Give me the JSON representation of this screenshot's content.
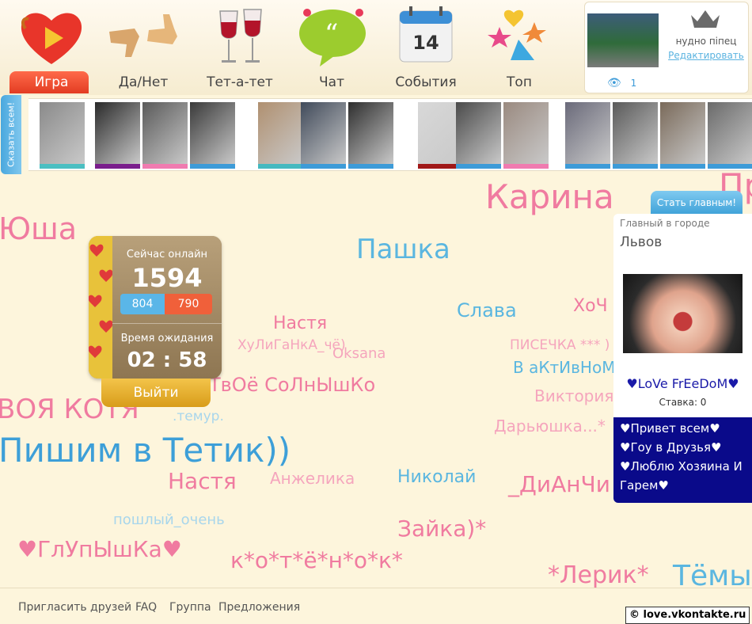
{
  "nav": [
    {
      "label": "Игра",
      "icon": "heart-play-icon",
      "active": true
    },
    {
      "label": "Да/Нет",
      "icon": "thumbs-up-down-icon",
      "active": false
    },
    {
      "label": "Тет-а-тет",
      "icon": "wine-glasses-icon",
      "active": false
    },
    {
      "label": "Чат",
      "icon": "chat-bubble-icon",
      "active": false
    },
    {
      "label": "События",
      "icon": "calendar-icon",
      "active": false
    },
    {
      "label": "Топ",
      "icon": "stars-bouquet-icon",
      "active": false
    }
  ],
  "calendar_day": "14",
  "profile": {
    "name": "нудно піпец",
    "edit_label": "Редактировать",
    "views": "1"
  },
  "say_all_label": "Сказать всем!",
  "strip_bar_colors": [
    "#4bbfc2",
    "#7a1e8c",
    "#f07bb0",
    "#3d9bd8",
    "#45b9c0",
    "#3d9bd8",
    "#3d9bd8",
    "#a01818",
    "#3d9bd8",
    "#f07bb0",
    "#3d9bd8",
    "#3d9bd8",
    "#3d9bd8",
    "#3d9bd8"
  ],
  "online": {
    "title": "Сейчас онлайн",
    "count": "1594",
    "male": "804",
    "female": "790",
    "wait_label": "Время ожидания",
    "timer": "02 : 58",
    "logout_label": "Выйти"
  },
  "main_in_city": {
    "button": "Стать главным!",
    "label": "Главный в городе",
    "city": "Львов",
    "nickname": "♥LoVe FrEeDoM♥",
    "bid": "Ставка: 0",
    "message": [
      "♥Привет всем♥",
      "♥Гоу в Друзья♥",
      "♥Люблю Хозяина И Гарем♥"
    ]
  },
  "cloud": [
    {
      "text": "Карина",
      "color": "#f07ba0"
    },
    {
      "text": "Пр",
      "color": "#f07ba0"
    },
    {
      "text": "Юша",
      "color": "#f07ba0"
    },
    {
      "text": "Пашка",
      "color": "#5ab6e0"
    },
    {
      "text": "Слава",
      "color": "#5ab6e0"
    },
    {
      "text": "ХоЧ",
      "color": "#f07ba0"
    },
    {
      "text": "Настя",
      "color": "#f07ba0"
    },
    {
      "text": "ХуЛиГаНкА_чё)",
      "color": "#f5a5bd"
    },
    {
      "text": "Oksana",
      "color": "#f5a5bd"
    },
    {
      "text": "ПИСЕЧКА *** )",
      "color": "#f5a5bd"
    },
    {
      "text": "В аКтИвНоМ",
      "color": "#5ab6e0"
    },
    {
      "text": "ТвОё СоЛнЫшКо",
      "color": "#f07ba0"
    },
    {
      "text": "Виктория",
      "color": "#f5a5bd"
    },
    {
      "text": "ВОЯ КОТЯ",
      "color": "#f07ba0"
    },
    {
      "text": ".темур.",
      "color": "#a8d6ec"
    },
    {
      "text": "Дарьюшка...*",
      "color": "#f5a5bd"
    },
    {
      "text": "Пишим в Тетик))",
      "color": "#3d9fd8"
    },
    {
      "text": "Настя",
      "color": "#f07ba0"
    },
    {
      "text": "Анжелика",
      "color": "#f5a5bd"
    },
    {
      "text": "Николай",
      "color": "#5ab6e0"
    },
    {
      "text": "_ДиАнЧи",
      "color": "#f07ba0"
    },
    {
      "text": "пошлый_очень",
      "color": "#a8d6ec"
    },
    {
      "text": "Зайка)*",
      "color": "#f07ba0"
    },
    {
      "text": "♥ГлУпЫшКа♥",
      "color": "#f07ba0"
    },
    {
      "text": "к*о*т*ё*н*о*к*",
      "color": "#f07ba0"
    },
    {
      "text": "*Лерик*",
      "color": "#f07ba0"
    },
    {
      "text": "Тёмы",
      "color": "#5ab6e0"
    }
  ],
  "footer": {
    "links": [
      "Пригласить друзей",
      "FAQ",
      "Группа",
      "Предложения"
    ],
    "copyright": "© love.vkontakte.ru"
  }
}
